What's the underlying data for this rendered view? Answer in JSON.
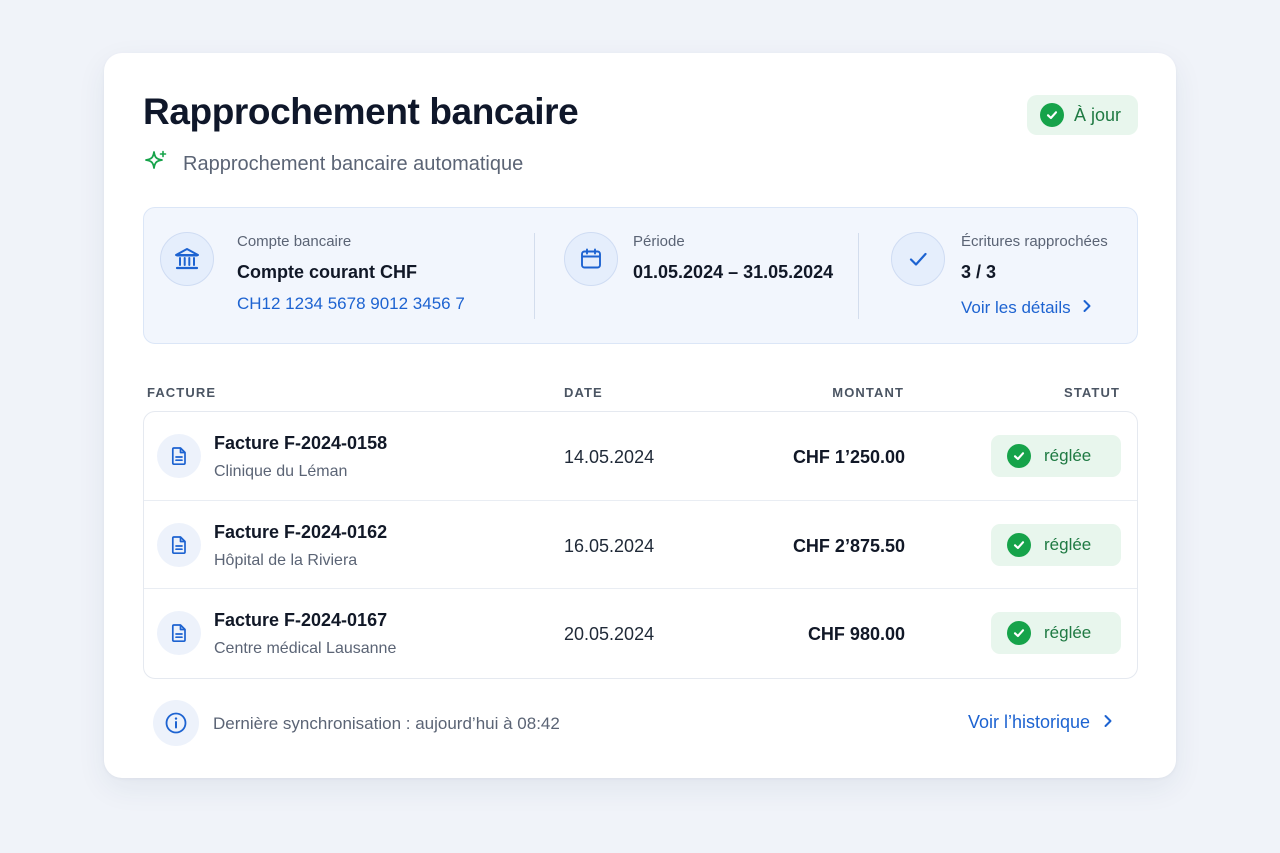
{
  "header": {
    "title": "Rapprochement bancaire",
    "subtitle": "Rapprochement bancaire automatique",
    "status_label": "À jour"
  },
  "summary": {
    "account": {
      "label": "Compte bancaire",
      "name": "Compte courant CHF",
      "iban": "CH12 1234 5678 9012 3456 7"
    },
    "period": {
      "label": "Période",
      "value": "01.05.2024 – 31.05.2024"
    },
    "matched": {
      "label": "Écritures rapprochées",
      "value": "3 / 3",
      "details_link": "Voir les détails"
    }
  },
  "table": {
    "columns": [
      "FACTURE",
      "DATE",
      "MONTANT",
      "STATUT"
    ],
    "rows": [
      {
        "title": "Facture F-2024-0158",
        "client": "Clinique du Léman",
        "date": "14.05.2024",
        "amount": "CHF 1’250.00",
        "status": "réglée"
      },
      {
        "title": "Facture F-2024-0162",
        "client": "Hôpital de la Riviera",
        "date": "16.05.2024",
        "amount": "CHF 2’875.50",
        "status": "réglée"
      },
      {
        "title": "Facture F-2024-0167",
        "client": "Centre médical Lausanne",
        "date": "20.05.2024",
        "amount": "CHF 980.00",
        "status": "réglée"
      }
    ]
  },
  "footer": {
    "sync_text": "Dernière synchronisation : aujourd’hui à 08:42",
    "history_link": "Voir l’historique"
  },
  "colors": {
    "accent": "#1d63d1",
    "success": "#16a34a",
    "success_bg": "#e8f6ed",
    "panel_bg": "#f2f6fd"
  },
  "icons": [
    "sparkle-icon",
    "bank-icon",
    "calendar-icon",
    "check-icon",
    "chevron-right-icon",
    "document-icon",
    "info-icon"
  ]
}
